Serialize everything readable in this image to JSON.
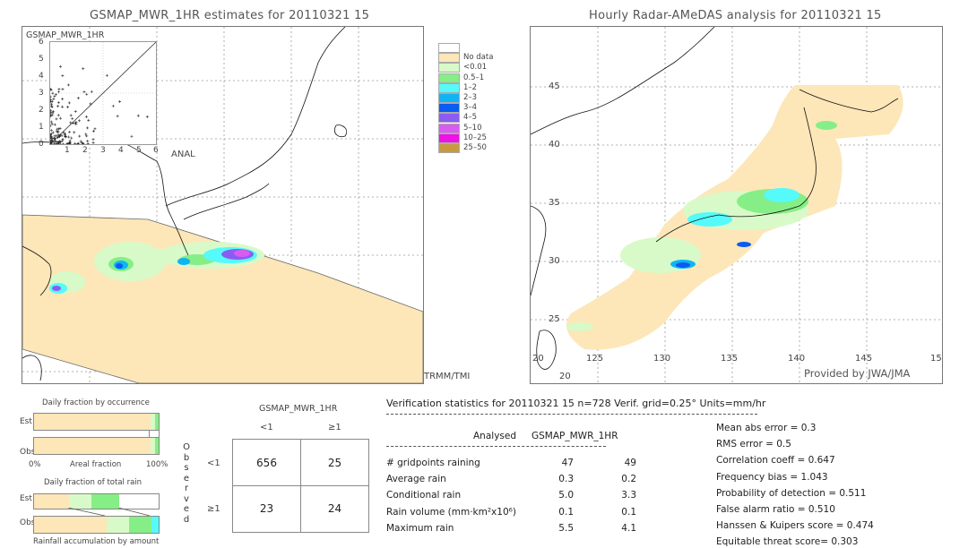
{
  "left_panel": {
    "title": "GSMAP_MWR_1HR estimates for 20110321 15",
    "scatter_ylabel": "GSMAP_MWR_1HR",
    "scatter_xlabel": "ANAL",
    "scatter_yticks": [
      "6",
      "5",
      "4",
      "3",
      "2",
      "1",
      "0"
    ],
    "scatter_xticks": [
      "1",
      "2",
      "3",
      "4",
      "5",
      "6"
    ],
    "sensor_label": "TRMM/TMI"
  },
  "legend": {
    "items": [
      {
        "label": "",
        "color": "#ffffff"
      },
      {
        "label": "No data",
        "color": "#fde6b8"
      },
      {
        "label": "<0.01",
        "color": "#d8fac8"
      },
      {
        "label": "0.5–1",
        "color": "#86ee86"
      },
      {
        "label": "1–2",
        "color": "#55fafa"
      },
      {
        "label": "2–3",
        "color": "#10b4f4"
      },
      {
        "label": "3–4",
        "color": "#0a5cf2"
      },
      {
        "label": "4–5",
        "color": "#8a5cf2"
      },
      {
        "label": "5–10",
        "color": "#d85cf0"
      },
      {
        "label": "10–25",
        "color": "#f010e8"
      },
      {
        "label": "25–50",
        "color": "#c89a40"
      }
    ]
  },
  "right_panel": {
    "title": "Hourly Radar-AMeDAS analysis for 20110321 15",
    "lat_labels": [
      "45",
      "40",
      "35",
      "30",
      "25",
      "20"
    ],
    "lon_labels": [
      "20",
      "125",
      "130",
      "135",
      "140",
      "145",
      "15"
    ],
    "bottom_lat_label": "20",
    "credit": "Provided by JWA/JMA"
  },
  "occurrence_chart": {
    "title": "Daily fraction by occurrence",
    "rows": [
      {
        "label": "Est",
        "segments": [
          {
            "color": "#fde6b8",
            "fraction": 0.935
          },
          {
            "color": "#d8fac8",
            "fraction": 0.035
          },
          {
            "color": "#86ee86",
            "fraction": 0.03
          }
        ]
      },
      {
        "label": "Obs",
        "segments": [
          {
            "color": "#fde6b8",
            "fraction": 0.935
          },
          {
            "color": "#d8fac8",
            "fraction": 0.035
          },
          {
            "color": "#86ee86",
            "fraction": 0.03
          }
        ]
      }
    ],
    "axis_left": "0%",
    "axis_center": "Areal fraction",
    "axis_right": "100%"
  },
  "rain_chart": {
    "title": "Daily fraction of total rain",
    "rows": [
      {
        "label": "Est",
        "segments": [
          {
            "color": "#fde6b8",
            "fraction": 0.28
          },
          {
            "color": "#d8fac8",
            "fraction": 0.18
          },
          {
            "color": "#86ee86",
            "fraction": 0.22
          }
        ]
      },
      {
        "label": "Obs",
        "segments": [
          {
            "color": "#fde6b8",
            "fraction": 0.58
          },
          {
            "color": "#d8fac8",
            "fraction": 0.18
          },
          {
            "color": "#86ee86",
            "fraction": 0.18
          },
          {
            "color": "#55fafa",
            "fraction": 0.06
          }
        ]
      }
    ],
    "footer": "Rainfall accumulation by amount"
  },
  "contingency": {
    "header": "GSMAP_MWR_1HR",
    "col_labels": [
      "<1",
      "≥1"
    ],
    "row_labels": [
      "<1",
      "≥1"
    ],
    "side_label": [
      "O",
      "b",
      "s",
      "e",
      "r",
      "v",
      "e",
      "d"
    ],
    "cells": [
      [
        "656",
        "25"
      ],
      [
        "23",
        "24"
      ]
    ]
  },
  "verification": {
    "header": "Verification statistics for 20110321 15   n=728   Verif. grid=0.25°   Units=mm/hr",
    "col_analysed": "Analysed",
    "col_estimate": "GSMAP_MWR_1HR",
    "rows": [
      {
        "label": "# gridpoints raining",
        "analysed": "47",
        "estimate": "49"
      },
      {
        "label": "Average rain",
        "analysed": "0.3",
        "estimate": "0.2"
      },
      {
        "label": "Conditional rain",
        "analysed": "5.0",
        "estimate": "3.3"
      },
      {
        "label": "Rain volume (mm·km²x10⁶)",
        "analysed": "0.1",
        "estimate": "0.1"
      },
      {
        "label": "Maximum rain",
        "analysed": "5.5",
        "estimate": "4.1"
      }
    ],
    "scores": [
      "Mean abs error = 0.3",
      "RMS error = 0.5",
      "Correlation coeff = 0.647",
      "Frequency bias = 1.043",
      "Probability of detection = 0.511",
      "False alarm ratio = 0.510",
      "Hanssen & Kuipers score = 0.474",
      "Equitable threat score= 0.303"
    ]
  }
}
